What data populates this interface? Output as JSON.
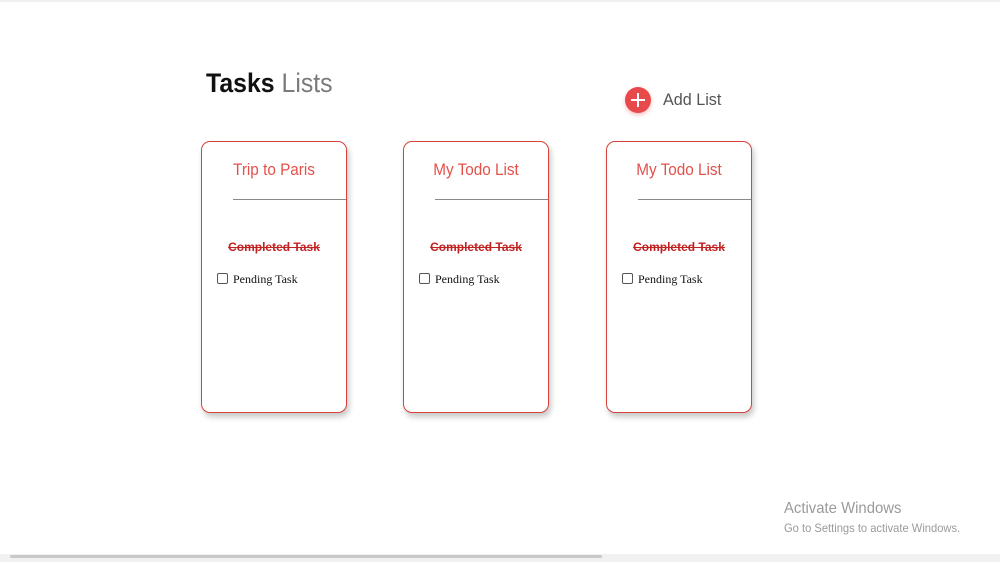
{
  "header": {
    "title_strong": "Tasks",
    "title_light": "Lists"
  },
  "add_list": {
    "icon": "plus-circle-icon",
    "label": "Add List"
  },
  "cards": [
    {
      "title": "Trip to Paris",
      "completed_task": "Completed Task",
      "pending_task": "Pending Task"
    },
    {
      "title": "My Todo List",
      "completed_task": "Completed Task",
      "pending_task": "Pending Task"
    },
    {
      "title": "My Todo List",
      "completed_task": "Completed Task",
      "pending_task": "Pending Task"
    }
  ],
  "watermark": {
    "line1": "Activate Windows",
    "line2": "Go to Settings to activate Windows."
  },
  "colors": {
    "accent": "#e8494a",
    "card_border": "#d7433c",
    "completed_text": "#c22121"
  }
}
